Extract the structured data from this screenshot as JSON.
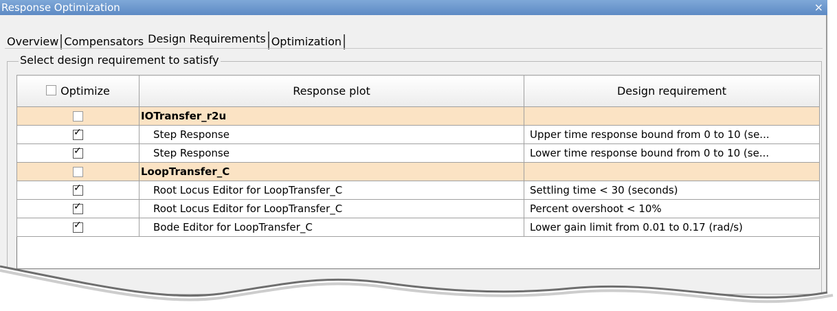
{
  "window": {
    "title": "Response Optimization",
    "close_glyph": "×"
  },
  "tabs": [
    {
      "label": "Overview"
    },
    {
      "label": "Compensators"
    },
    {
      "label": "Design Requirements"
    },
    {
      "label": "Optimization"
    }
  ],
  "group": {
    "label": "Select design requirement to satisfy"
  },
  "table": {
    "columns": [
      "Optimize",
      "Response plot",
      "Design requirement"
    ],
    "rows": [
      {
        "type": "group",
        "checked": false,
        "plot": "IOTransfer_r2u",
        "requirement": ""
      },
      {
        "type": "item",
        "checked": true,
        "plot": "Step Response",
        "requirement": "Upper time response bound from 0 to 10 (se..."
      },
      {
        "type": "item",
        "checked": true,
        "plot": "Step Response",
        "requirement": "Lower time response bound from 0 to 10 (se..."
      },
      {
        "type": "group",
        "checked": false,
        "plot": "LoopTransfer_C",
        "requirement": ""
      },
      {
        "type": "item",
        "checked": true,
        "plot": "Root Locus Editor for LoopTransfer_C",
        "requirement": "Settling time < 30 (seconds)"
      },
      {
        "type": "item",
        "checked": true,
        "plot": "Root Locus Editor for LoopTransfer_C",
        "requirement": "Percent overshoot < 10%"
      },
      {
        "type": "item",
        "checked": true,
        "plot": "Bode Editor for LoopTransfer_C",
        "requirement": "Lower gain limit from 0.01 to 0.17 (rad/s)"
      }
    ]
  },
  "colors": {
    "titlebar": "#5d8ac4",
    "group_row": "#fbe3c4",
    "pane": "#f0f0f0"
  }
}
